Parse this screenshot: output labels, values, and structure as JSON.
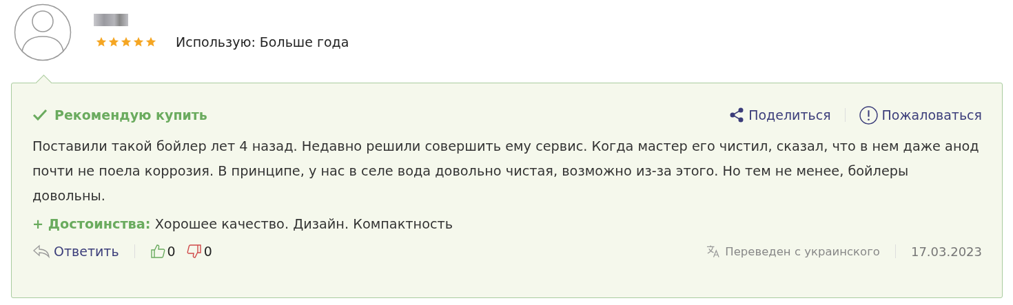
{
  "reviewer": {
    "stars": 5,
    "usage": "Использую: Больше года"
  },
  "review": {
    "verdict": "Рекомендую купить",
    "recommended": true,
    "actions": [
      {
        "kind": "share",
        "label": "Поделиться"
      },
      {
        "kind": "report",
        "label": "Пожаловаться"
      }
    ],
    "text": "Поставили такой бойлер лет 4 назад. Недавно решили совершить ему сервис. Когда мастер его чистил, сказал, что в нем даже анод почти не поела коррозия. В принципе, у нас в селе вода довольно чистая, возможно из-за этого. Но тем не менее, бойлеры довольны.",
    "pros_label": "+ Достоинства:",
    "pros": "Хорошее качество. Дизайн. Компактность",
    "reply": "Ответить",
    "likes": "0",
    "dislikes": "0",
    "translated": "Переведен с украинского",
    "date": "17.03.2023"
  }
}
